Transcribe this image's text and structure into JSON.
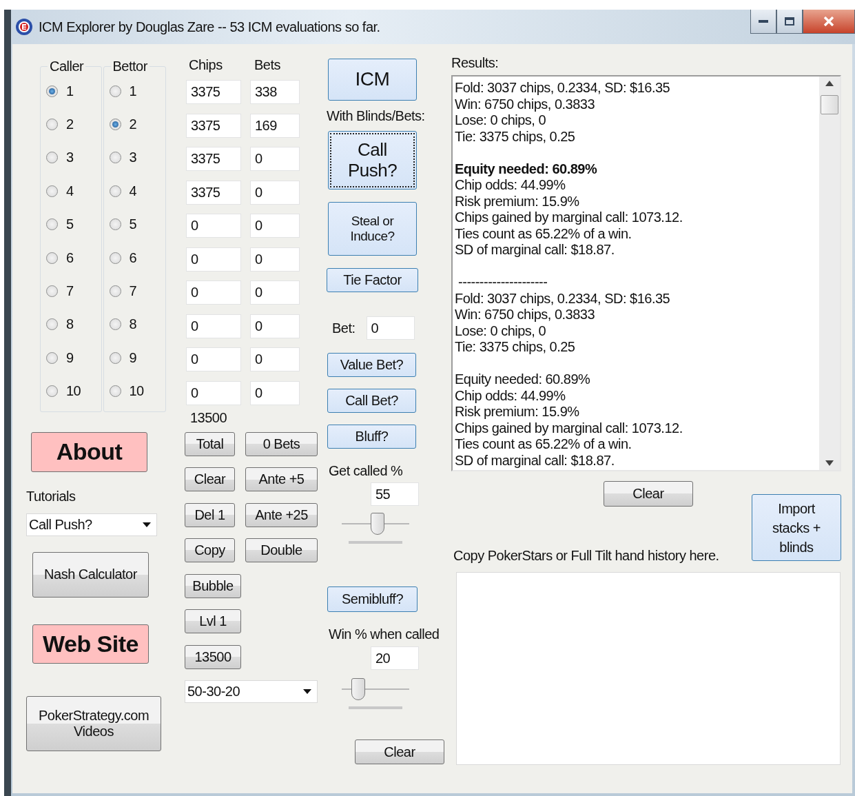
{
  "window": {
    "title": "ICM Explorer by Douglas Zare -- 53 ICM evaluations so far."
  },
  "caller": {
    "label": "Caller",
    "options": [
      {
        "label": "1",
        "selected": true
      },
      {
        "label": "2",
        "selected": false
      },
      {
        "label": "3",
        "selected": false
      },
      {
        "label": "4",
        "selected": false
      },
      {
        "label": "5",
        "selected": false
      },
      {
        "label": "6",
        "selected": false
      },
      {
        "label": "7",
        "selected": false
      },
      {
        "label": "8",
        "selected": false
      },
      {
        "label": "9",
        "selected": false
      },
      {
        "label": "10",
        "selected": false
      }
    ]
  },
  "bettor": {
    "label": "Bettor",
    "options": [
      {
        "label": "1",
        "selected": false
      },
      {
        "label": "2",
        "selected": true
      },
      {
        "label": "3",
        "selected": false
      },
      {
        "label": "4",
        "selected": false
      },
      {
        "label": "5",
        "selected": false
      },
      {
        "label": "6",
        "selected": false
      },
      {
        "label": "7",
        "selected": false
      },
      {
        "label": "8",
        "selected": false
      },
      {
        "label": "9",
        "selected": false
      },
      {
        "label": "10",
        "selected": false
      }
    ]
  },
  "about_button": {
    "label": "About",
    "kind": "pink"
  },
  "tutorials": {
    "label": "Tutorials",
    "value": "Call Push?"
  },
  "nash_button": {
    "label": "Nash Calculator",
    "kind": "plain"
  },
  "website_button": {
    "label": "Web Site",
    "kind": "pink"
  },
  "videos_button": {
    "label": "PokerStrategy.com Videos",
    "kind": "plain"
  },
  "stacks": {
    "chips_label": "Chips",
    "bets_label": "Bets",
    "total": "13500",
    "rows": [
      {
        "chips": "3375",
        "bets": "338"
      },
      {
        "chips": "3375",
        "bets": "169"
      },
      {
        "chips": "3375",
        "bets": "0"
      },
      {
        "chips": "3375",
        "bets": "0"
      },
      {
        "chips": "0",
        "bets": "0"
      },
      {
        "chips": "0",
        "bets": "0"
      },
      {
        "chips": "0",
        "bets": "0"
      },
      {
        "chips": "0",
        "bets": "0"
      },
      {
        "chips": "0",
        "bets": "0"
      },
      {
        "chips": "0",
        "bets": "0"
      }
    ]
  },
  "stack_button_rows": [
    [
      "Total",
      "0 Bets"
    ],
    [
      "Clear",
      "Ante +5"
    ],
    [
      "Del 1",
      "Ante +25"
    ],
    [
      "Copy",
      "Double"
    ],
    [
      "Bubble"
    ],
    [
      "Lvl 1"
    ],
    [
      "13500"
    ]
  ],
  "payout": {
    "value": "50-30-20"
  },
  "icm_button": {
    "label": "ICM",
    "kind": "blue"
  },
  "blinds_label": "With Blinds/Bets:",
  "call_push_button": {
    "label": "Call Push?",
    "kind": "blue"
  },
  "steal_button": {
    "label": "Steal or Induce?",
    "kind": "blue"
  },
  "tie_factor_button": {
    "label": "Tie Factor",
    "kind": "blue"
  },
  "bet": {
    "label": "Bet:",
    "value": "0"
  },
  "value_bet_button": {
    "label": "Value Bet?",
    "kind": "blue"
  },
  "call_bet_button": {
    "label": "Call Bet?",
    "kind": "blue"
  },
  "bluff_button": {
    "label": "Bluff?",
    "kind": "blue"
  },
  "get_called": {
    "label": "Get called %",
    "value": "55",
    "level": 0.53
  },
  "semibluff_button": {
    "label": "Semibluff?",
    "kind": "blue"
  },
  "win_when_called": {
    "label": "Win % when called",
    "value": "20",
    "level": 0.24
  },
  "clear_button": {
    "label": "Clear",
    "kind": "plain"
  },
  "results": {
    "label": "Results:",
    "lines": [
      {
        "kind": "text",
        "text": "Fold: 3037 chips, 0.2334, SD: $16.35"
      },
      {
        "kind": "text",
        "text": "Win: 6750 chips, 0.3833"
      },
      {
        "kind": "text",
        "text": "Lose: 0 chips, 0"
      },
      {
        "kind": "text",
        "text": "Tie: 3375 chips, 0.25"
      },
      {
        "kind": "gap"
      },
      {
        "kind": "bold",
        "text": "Equity needed: 60.89%"
      },
      {
        "kind": "text",
        "text": "Chip odds: 44.99%"
      },
      {
        "kind": "text",
        "text": "Risk premium: 15.9%"
      },
      {
        "kind": "text",
        "text": "Chips gained by marginal call: 1073.12."
      },
      {
        "kind": "text",
        "text": "Ties count as 65.22% of a win."
      },
      {
        "kind": "text",
        "text": "SD of marginal call: $18.87."
      },
      {
        "kind": "gap"
      },
      {
        "kind": "text",
        "text": " ---------------------"
      },
      {
        "kind": "text",
        "text": "Fold: 3037 chips, 0.2334, SD: $16.35"
      },
      {
        "kind": "text",
        "text": "Win: 6750 chips, 0.3833"
      },
      {
        "kind": "text",
        "text": "Lose: 0 chips, 0"
      },
      {
        "kind": "text",
        "text": "Tie: 3375 chips, 0.25"
      },
      {
        "kind": "gap"
      },
      {
        "kind": "text",
        "text": "Equity needed: 60.89%"
      },
      {
        "kind": "text",
        "text": "Chip odds: 44.99%"
      },
      {
        "kind": "text",
        "text": "Risk premium: 15.9%"
      },
      {
        "kind": "text",
        "text": "Chips gained by marginal call: 1073.12."
      },
      {
        "kind": "text",
        "text": "Ties count as 65.22% of a win."
      },
      {
        "kind": "text",
        "text": "SD of marginal call: $18.87."
      }
    ]
  },
  "results_clear_button": {
    "label": "Clear",
    "kind": "plain"
  },
  "import_button": {
    "label": "Import stacks + blinds",
    "kind": "blue"
  },
  "history": {
    "label": "Copy PokerStars or Full Tilt hand history here."
  }
}
